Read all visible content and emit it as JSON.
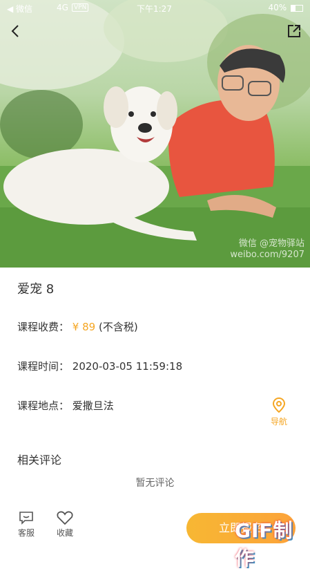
{
  "status_bar": {
    "carrier": "◀ 微信",
    "network": "4G",
    "vpn": "VPN",
    "time": "下午1:27",
    "battery": "40%"
  },
  "hero": {
    "watermark_line1": "微信  @宠物驿站",
    "watermark_line2": "weibo.com/9207"
  },
  "course": {
    "name": "爱宠 8",
    "fee_label": "课程收费：",
    "fee_value": "¥ 89",
    "fee_note": "(不含税)",
    "time_label": "课程时间：",
    "time_value": "2020-03-05 11:59:18",
    "location_label": "课程地点：",
    "location_value": "爱撒旦法",
    "nav_label": "导航"
  },
  "comments": {
    "title": "相关评论",
    "empty_text": "暂无评论"
  },
  "bottom_bar": {
    "service_label": "客服",
    "favorite_label": "收藏",
    "cta_label": "立即报名",
    "gif_badge": "GIF制作"
  },
  "colors": {
    "accent": "#f5a623",
    "text": "#333333"
  }
}
